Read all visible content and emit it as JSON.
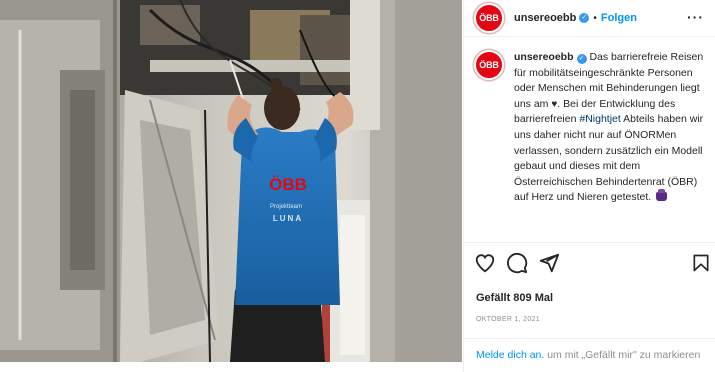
{
  "post": {
    "username": "unsereoebb",
    "avatar_text": "ÖBB",
    "follow_label": "Folgen",
    "separator": "•",
    "more_label": "···",
    "caption_part1": "Das barrierefreie Reisen für mobilitätseingeschränkte Personen oder Menschen mit Behinderungen liegt uns am ",
    "heart_glyph": "♥",
    "caption_part2": ". Bei der Entwicklung des barrierefreien ",
    "hashtag": "#Nightjet",
    "caption_part3": " Abteils haben wir uns daher nicht nur auf ÖNORMen verlassen, sondern zusätzlich ein Modell gebaut und dieses mit dem Österreichischen Behindertenrat (ÖBR) auf Herz und Nieren getestet.",
    "likes_text": "Gefällt 809 Mal",
    "date_text": "OKTOBER 1, 2021",
    "login_link": "Melde dich an.",
    "login_rest": " um mit „Gefällt mir\" zu markieren"
  },
  "photo": {
    "shirt_logo": "ÖBB",
    "shirt_line1": "Projektteam",
    "shirt_line2": "LUNA",
    "shirt_color": "#1f6fb8",
    "brand_red": "#e30613"
  },
  "icons": {
    "like": "heart-outline-icon",
    "comment": "comment-icon",
    "share": "paper-plane-icon",
    "save": "bookmark-icon",
    "verified": "verified-badge-icon",
    "more": "more-dots-icon"
  }
}
